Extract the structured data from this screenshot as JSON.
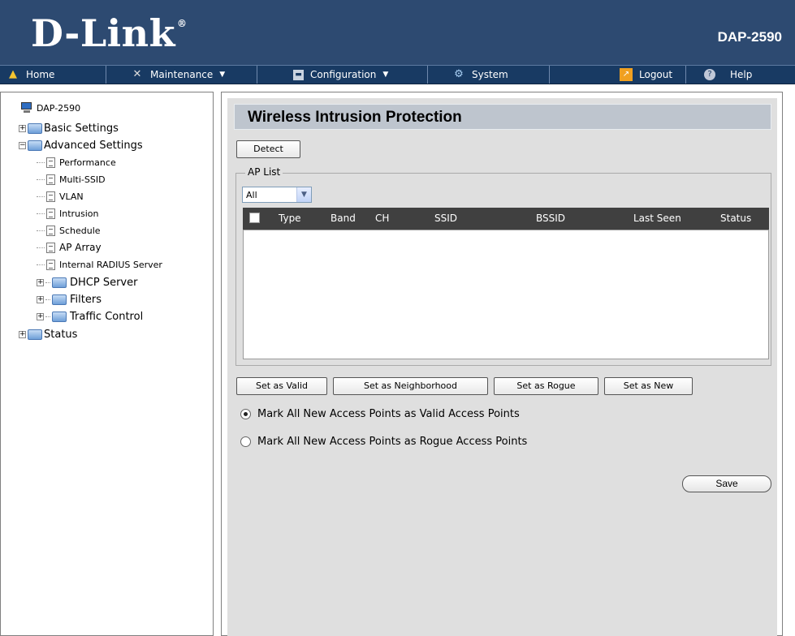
{
  "header": {
    "logo": "D-Link",
    "registered": "®",
    "model": "DAP-2590"
  },
  "menu": [
    {
      "label": "Home",
      "icon": "home-icon",
      "has_caret": false
    },
    {
      "label": "Maintenance",
      "icon": "tools-icon",
      "has_caret": true
    },
    {
      "label": "Configuration",
      "icon": "floppy-disk-icon",
      "has_caret": true
    },
    {
      "label": "System",
      "icon": "system-icon",
      "has_caret": false
    },
    {
      "label": "Logout",
      "icon": "logout-icon",
      "has_caret": false
    },
    {
      "label": "Help",
      "icon": "help-icon",
      "has_caret": false
    }
  ],
  "tree": {
    "root": "DAP-2590",
    "basic": "Basic Settings",
    "advanced": "Advanced Settings",
    "performance": "Performance",
    "multi_ssid": "Multi-SSID",
    "vlan": "VLAN",
    "intrusion": "Intrusion",
    "schedule": "Schedule",
    "ap_array": "AP Array",
    "radius": "Internal RADIUS Server",
    "dhcp": "DHCP Server",
    "filters": "Filters",
    "traffic": "Traffic Control",
    "status": "Status"
  },
  "page": {
    "title": "Wireless Intrusion Protection",
    "detect_button": "Detect",
    "ap_list_legend": "AP List",
    "filter_selected": "All",
    "columns": [
      "Type",
      "Band",
      "CH",
      "SSID",
      "BSSID",
      "Last Seen",
      "Status"
    ],
    "rows": [],
    "buttons": {
      "set_valid": "Set as Valid",
      "set_neighborhood": "Set as Neighborhood",
      "set_rogue": "Set as Rogue",
      "set_new": "Set as New"
    },
    "radio_valid": "Mark All New Access Points as Valid Access Points",
    "radio_rogue": "Mark All New Access Points as Rogue Access Points",
    "radio_selected": "valid",
    "save_button": "Save"
  },
  "colors": {
    "header_bg": "#2d4a71",
    "menubar_bg": "#183a63",
    "panel_bg": "#dfdfdf",
    "title_bar_bg": "#bec5ce",
    "table_header_bg": "#404040"
  }
}
